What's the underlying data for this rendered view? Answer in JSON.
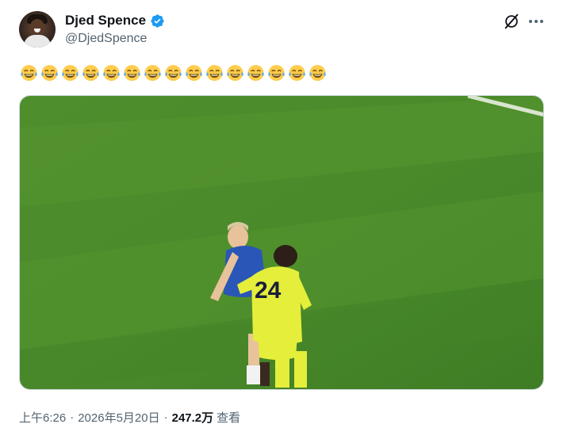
{
  "author": {
    "name": "Djed Spence",
    "handle": "@DjedSpence",
    "verified": true
  },
  "icons": {
    "verified": "verified-badge-icon",
    "grok": "grok-icon",
    "more": "more-options-icon",
    "emoji": "face-with-tears-of-joy"
  },
  "tweet": {
    "emoji_count": 15
  },
  "media": {
    "jersey_number": "24"
  },
  "meta": {
    "time": "上午6:26",
    "separator": "·",
    "date": "2026年5月20日",
    "views_count": "247.2万",
    "views_label": "查看"
  },
  "colors": {
    "verified_blue": "#1d9bf0",
    "secondary_text": "#536471",
    "pitch_green": "#4d8a2c",
    "kit_yellow": "#e5ee3a"
  }
}
